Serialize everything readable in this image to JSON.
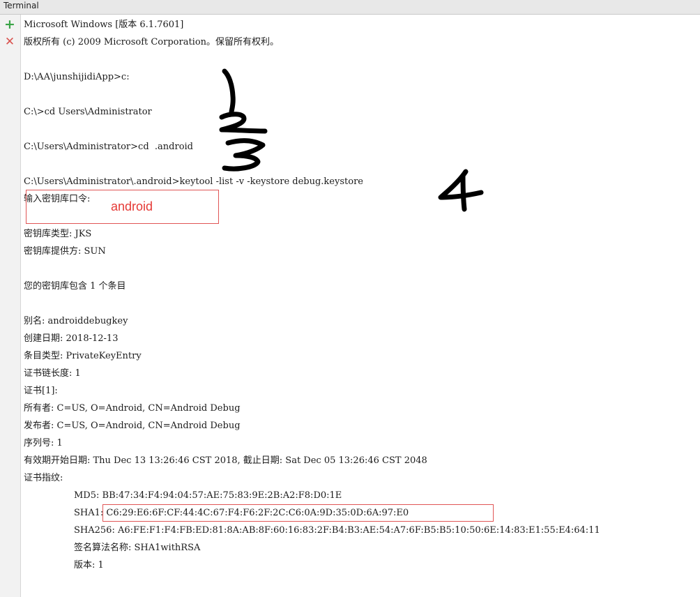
{
  "window": {
    "title": "Terminal"
  },
  "gutter": {
    "add_icon": "+",
    "close_icon": "✕"
  },
  "console": {
    "lines": [
      "Microsoft Windows [版本 6.1.7601]",
      "版权所有 (c) 2009 Microsoft Corporation。保留所有权利。",
      "",
      "D:\\AA\\junshijidiApp>c:",
      "",
      "C:\\>cd Users\\Administrator",
      "",
      "C:\\Users\\Administrator>cd  .android",
      "",
      "C:\\Users\\Administrator\\.android>keytool -list -v -keystore debug.keystore",
      "输入密钥库口令:",
      "",
      "密钥库类型: JKS",
      "密钥库提供方: SUN",
      "",
      "您的密钥库包含 1 个条目",
      "",
      "别名: androiddebugkey",
      "创建日期: 2018-12-13",
      "条目类型: PrivateKeyEntry",
      "证书链长度: 1",
      "证书[1]:",
      "所有者: C=US, O=Android, CN=Android Debug",
      "发布者: C=US, O=Android, CN=Android Debug",
      "序列号: 1",
      "有效期开始日期: Thu Dec 13 13:26:46 CST 2018, 截止日期: Sat Dec 05 13:26:46 CST 2048",
      "证书指纹:",
      "MD5: BB:47:34:F4:94:04:57:AE:75:83:9E:2B:A2:F8:D0:1E",
      "SHA1: C6:29:E6:6F:CF:44:4C:67:F4:F6:2F:2C:C6:0A:9D:35:0D:6A:97:E0",
      "SHA256: A6:FE:F1:F4:FB:ED:81:8A:AB:8F:60:16:83:2F:B4:B3:AE:54:A7:6F:B5:B5:10:50:6E:14:83:E1:55:E4:64:11",
      "签名算法名称: SHA1withRSA",
      "版本: 1"
    ]
  },
  "annotations": {
    "password_label": "android",
    "step_1": "1",
    "step_2": "2",
    "step_3": "3",
    "step_4": "4"
  }
}
